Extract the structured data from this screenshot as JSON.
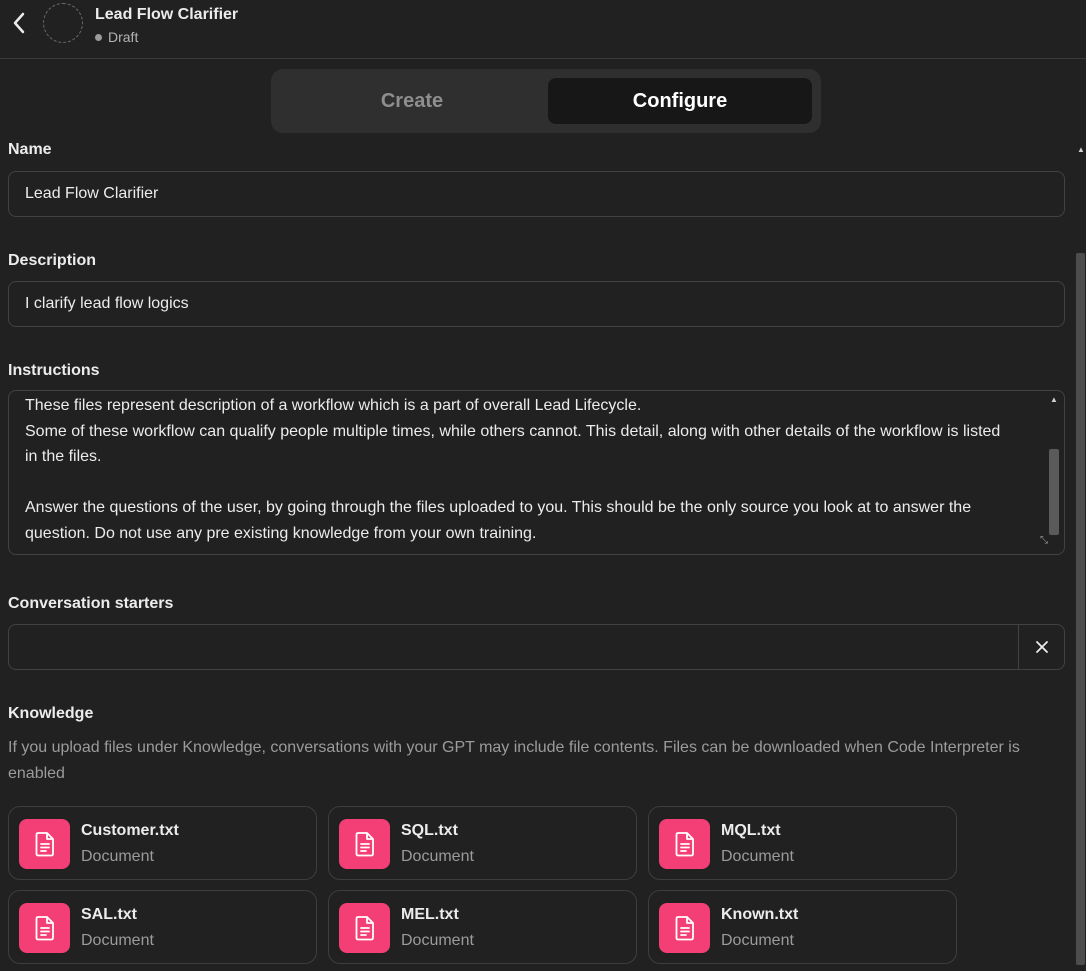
{
  "header": {
    "title": "Lead Flow Clarifier",
    "status": "Draft"
  },
  "tabs": [
    {
      "label": "Create",
      "active": false
    },
    {
      "label": "Configure",
      "active": true
    }
  ],
  "form": {
    "name": {
      "label": "Name",
      "value": "Lead Flow Clarifier"
    },
    "description": {
      "label": "Description",
      "value": "I clarify lead flow logics"
    },
    "instructions": {
      "label": "Instructions",
      "value": "These files represent description of a workflow which is a part of overall Lead Lifecycle.\nSome of these workflow can qualify people multiple times, while others cannot. This detail, along with other details of the workflow is listed in the files.\n\nAnswer the questions of the user, by going through the files uploaded to you. This should be the only source you look at to answer the question. Do not use any pre existing knowledge from your own training."
    },
    "conversation_starters": {
      "label": "Conversation starters",
      "value": ""
    }
  },
  "knowledge": {
    "label": "Knowledge",
    "description": "If you upload files under Knowledge, conversations with your GPT may include file contents. Files can be downloaded when Code Interpreter is enabled",
    "files": [
      {
        "name": "Customer.txt",
        "type": "Document"
      },
      {
        "name": "SQL.txt",
        "type": "Document"
      },
      {
        "name": "MQL.txt",
        "type": "Document"
      },
      {
        "name": "SAL.txt",
        "type": "Document"
      },
      {
        "name": "MEL.txt",
        "type": "Document"
      },
      {
        "name": "Known.txt",
        "type": "Document"
      }
    ]
  },
  "colors": {
    "background": "#212121",
    "file_icon_accent": "#f43f76",
    "border": "#424242"
  }
}
